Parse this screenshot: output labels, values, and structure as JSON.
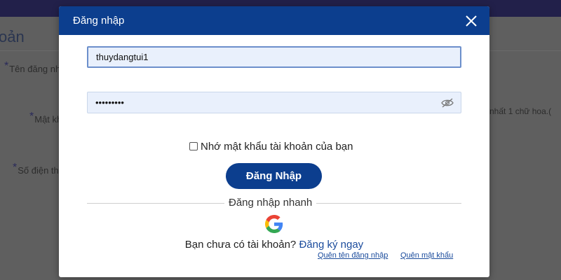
{
  "background": {
    "page_title": "oản",
    "labels": [
      "Tên đăng nh",
      "Mật kh",
      "Số điện th"
    ],
    "hint_text": "nhất 1 chữ hoa.("
  },
  "modal": {
    "title": "Đăng nhập",
    "username": {
      "value": "thuydangtui1"
    },
    "password": {
      "value": "•••••••••"
    },
    "remember_label": "Nhớ mật khẩu tài khoản của bạn",
    "remember_checked": false,
    "login_button": "Đăng Nhập",
    "quick_login_label": "Đăng nhập nhanh",
    "signup_prompt": "Bạn chưa có tài khoản?",
    "signup_link": "Đăng ký ngay",
    "forgot_username": "Quên tên đăng nhập",
    "forgot_password": "Quên mật khẩu"
  },
  "colors": {
    "header": "#0c3e8e",
    "overlay": "#5f5f5f",
    "input_bg": "#e9f0fc",
    "link": "#1a4b9c"
  },
  "icons": [
    "close-icon",
    "eye-slash-icon",
    "checkbox",
    "google-icon"
  ]
}
